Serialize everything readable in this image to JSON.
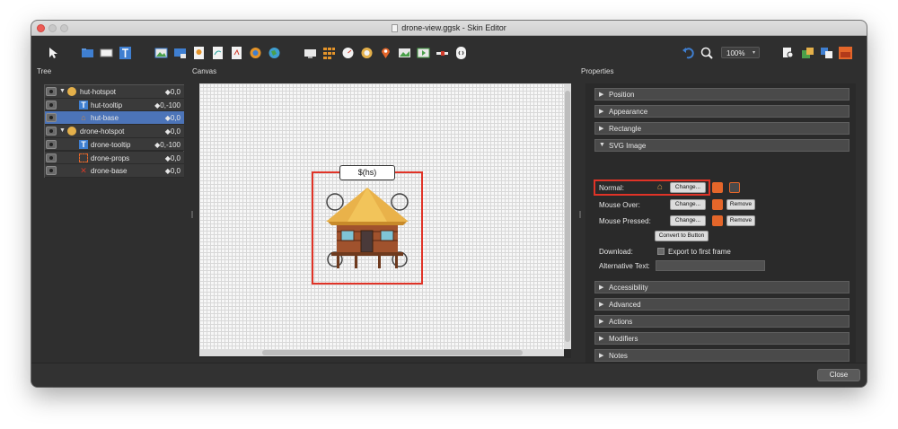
{
  "window": {
    "title": "drone-view.ggsk - Skin Editor"
  },
  "toolbar": {
    "zoom_value": "100%"
  },
  "panels": {
    "tree_label": "Tree",
    "canvas_label": "Canvas",
    "properties_label": "Properties"
  },
  "tree": {
    "rows": [
      {
        "name": "hut-hotspot",
        "pos": "◆0,0",
        "icon": "hotspot-icon",
        "expanded": true
      },
      {
        "name": "hut-tooltip",
        "pos": "◆0,-100",
        "icon": "text-icon"
      },
      {
        "name": "hut-base",
        "pos": "◆0,0",
        "icon": "image-icon",
        "selected": true
      },
      {
        "name": "drone-hotspot",
        "pos": "◆0,0",
        "icon": "hotspot-icon",
        "expanded": true
      },
      {
        "name": "drone-tooltip",
        "pos": "◆0,-100",
        "icon": "text-icon"
      },
      {
        "name": "drone-props",
        "pos": "◆0,0",
        "icon": "container-icon"
      },
      {
        "name": "drone-base",
        "pos": "◆0,0",
        "icon": "image-icon"
      }
    ]
  },
  "canvas": {
    "tooltip_text": "$(hs)"
  },
  "properties": {
    "sections_top": [
      "Position",
      "Appearance",
      "Rectangle"
    ],
    "svg_section": "SVG Image",
    "normal_label": "Normal:",
    "mouse_over_label": "Mouse Over:",
    "mouse_pressed_label": "Mouse Pressed:",
    "change_label": "Change...",
    "remove_label": "Remove",
    "convert_label": "Convert to Button",
    "download_label": "Download:",
    "export_label": "Export to first frame",
    "alt_text_label": "Alternative Text:",
    "sections_bottom": [
      "Accessibility",
      "Advanced",
      "Actions",
      "Modifiers",
      "Notes"
    ]
  },
  "footer": {
    "close_label": "Close"
  },
  "colors": {
    "accent_red": "#e03327",
    "selection_blue": "#4c74b8"
  }
}
